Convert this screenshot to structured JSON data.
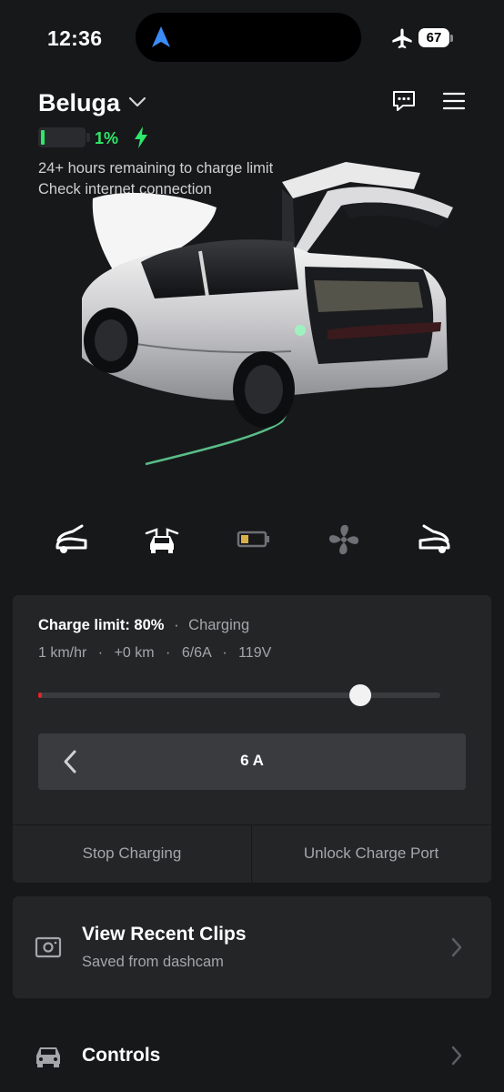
{
  "status_bar": {
    "time": "12:36",
    "battery_level": "67",
    "icons": [
      "navigation-arrow-icon",
      "airplane-icon",
      "battery-icon"
    ]
  },
  "header": {
    "vehicle_name": "Beluga",
    "battery_percent": "1%",
    "battery_fraction": 0.01,
    "status_lines": [
      "24+ hours remaining to charge limit",
      "Check internet connection"
    ],
    "icons": [
      "chevron-down-icon",
      "message-icon",
      "menu-icon",
      "charging-bolt-icon"
    ]
  },
  "quick_controls": [
    {
      "name": "frunk-icon",
      "active": false
    },
    {
      "name": "falcon-doors-icon",
      "active": false
    },
    {
      "name": "battery-icon",
      "active": true
    },
    {
      "name": "fan-icon",
      "active": false
    },
    {
      "name": "trunk-icon",
      "active": false
    }
  ],
  "charging": {
    "limit_label": "Charge limit: 80%",
    "separator": "·",
    "state": "Charging",
    "stats": [
      "1 km/hr",
      "+0 km",
      "6/6A",
      "119V"
    ],
    "current_charge_fraction": 0.01,
    "limit_fraction": 0.8,
    "amps": "6 A",
    "stop_button": "Stop Charging",
    "unlock_button": "Unlock Charge Port"
  },
  "clips": {
    "title": "View Recent Clips",
    "subtitle": "Saved from dashcam"
  },
  "controls": {
    "label": "Controls"
  },
  "colors": {
    "background": "#17181a",
    "card": "#242527",
    "charge_green": "#2ee86a",
    "slider_red": "#e0242a",
    "muted_text": "#a5a6a9",
    "nav_blue": "#3b8cf6"
  }
}
